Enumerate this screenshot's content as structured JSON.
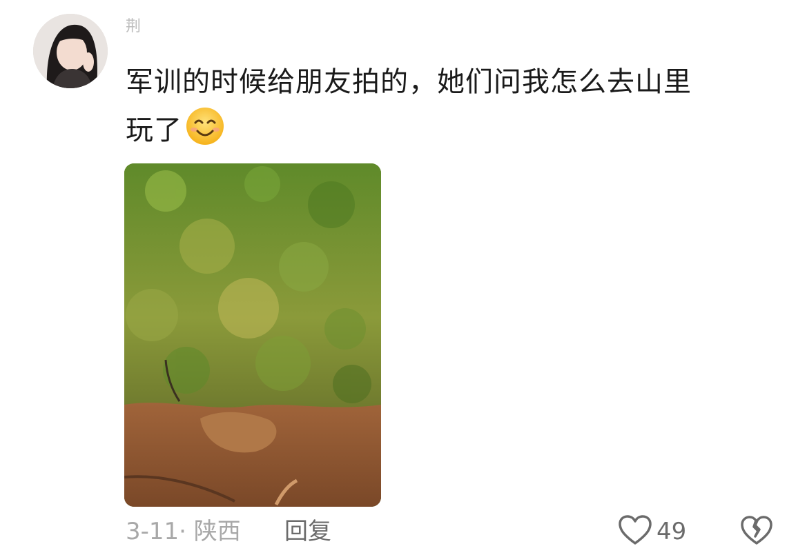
{
  "comment": {
    "username": "荆",
    "text_line1": "军训的时候给朋友拍的，她们问我怎么去山里",
    "text_line2": "玩了",
    "emoji": "smiling-face-icon",
    "date": "3-11",
    "separator": "·",
    "location": "陕西",
    "reply_label": "回复",
    "like_count": "49"
  },
  "colors": {
    "text": "#1a1a1a",
    "meta": "#a8a8a8",
    "action": "#6b6b6b"
  }
}
